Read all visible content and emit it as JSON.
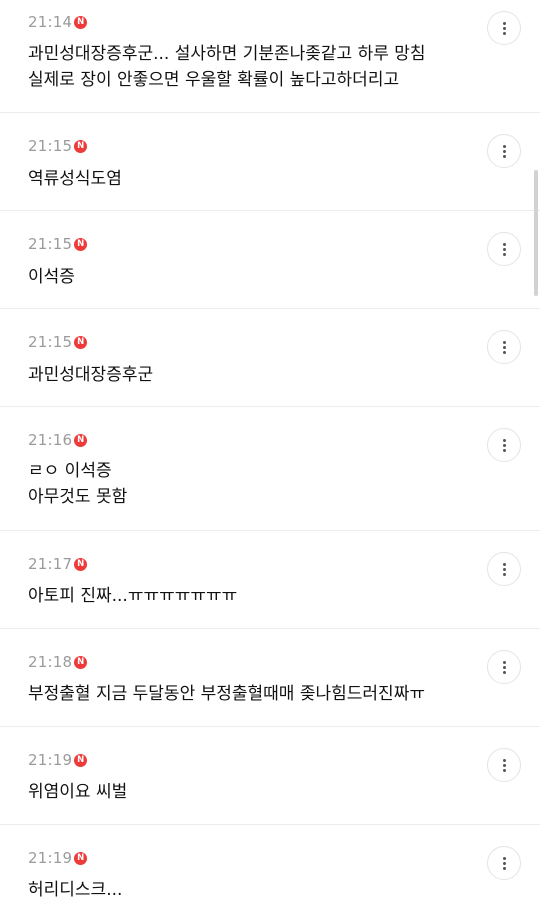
{
  "comments": [
    {
      "time": "21:14",
      "badge": "N",
      "text": "과민성대장증후군... 설사하면 기분존나좆같고 하루 망침\n실제로 장이 안좋으면 우울할 확률이 높다고하더리고"
    },
    {
      "time": "21:15",
      "badge": "N",
      "text": "역류성식도염"
    },
    {
      "time": "21:15",
      "badge": "N",
      "text": "이석증"
    },
    {
      "time": "21:15",
      "badge": "N",
      "text": "과민성대장증후군"
    },
    {
      "time": "21:16",
      "badge": "N",
      "text": "ㄹㅇ 이석증\n아무것도 못함"
    },
    {
      "time": "21:17",
      "badge": "N",
      "text": "아토피 진짜...ㅠㅠㅠㅠㅠㅠㅠ"
    },
    {
      "time": "21:18",
      "badge": "N",
      "text": "부정출혈 지금 두달동안 부정출혈때매 좆나힘드러진짜ㅠ"
    },
    {
      "time": "21:19",
      "badge": "N",
      "text": "위염이요 씨벌"
    },
    {
      "time": "21:19",
      "badge": "N",
      "text": "허리디스크..."
    }
  ]
}
